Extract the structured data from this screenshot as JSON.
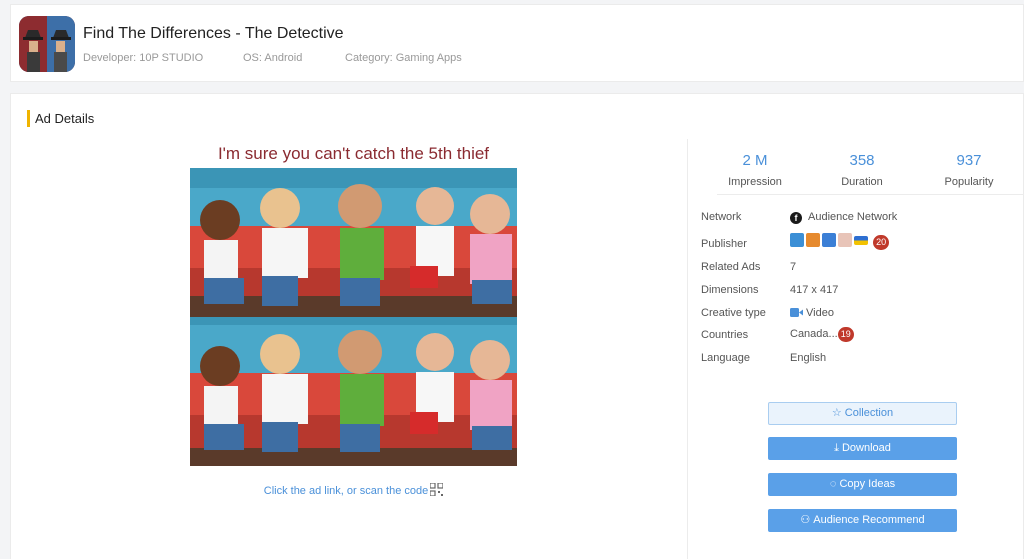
{
  "app": {
    "title": "Find The Differences - The Detective",
    "developer": "Developer: 10P STUDIO",
    "os": "OS: Android",
    "category": "Category: Gaming Apps"
  },
  "section": {
    "title": "Ad Details"
  },
  "ad": {
    "caption": "I'm sure you can't catch the 5th thief",
    "hint": "Click the ad link, or scan the code"
  },
  "stats": [
    {
      "value": "2 M",
      "label": "Impression"
    },
    {
      "value": "358",
      "label": "Duration"
    },
    {
      "value": "937",
      "label": "Popularity"
    }
  ],
  "info": {
    "network": {
      "label": "Network",
      "value": "Audience Network"
    },
    "publisher": {
      "label": "Publisher",
      "badge": "20",
      "icons": [
        "publisher-app-icon-99",
        "publisher-app-icon-2",
        "publisher-app-icon-clock",
        "publisher-app-icon-4",
        "publisher-app-icon-flag"
      ]
    },
    "related_ads": {
      "label": "Related Ads",
      "value": "7"
    },
    "dimensions": {
      "label": "Dimensions",
      "value": "417 x 417"
    },
    "creative_type": {
      "label": "Creative type",
      "value": "Video"
    },
    "countries": {
      "label": "Countries",
      "value": "Canada...",
      "badge": "19"
    },
    "language": {
      "label": "Language",
      "value": "English"
    }
  },
  "buttons": {
    "collection": "Collection",
    "download": "Download",
    "copy_ideas": "Copy Ideas",
    "audience_recommend": "Audience Recommend"
  },
  "colors": {
    "accent": "#4a90d9",
    "button": "#5aa0e8",
    "section_marker": "#f0b400",
    "badge": "#c0392b",
    "caption": "#8a2a30"
  }
}
